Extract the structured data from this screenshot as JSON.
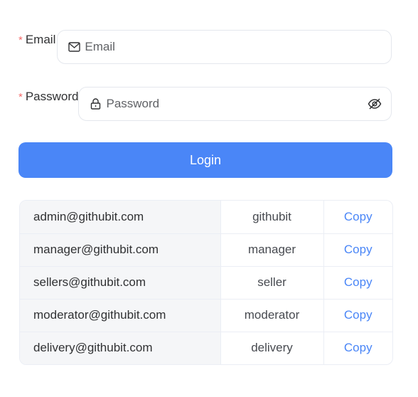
{
  "form": {
    "email": {
      "label": "Email",
      "required_mark": "*",
      "placeholder": "Email",
      "value": "",
      "icon": "mail-icon"
    },
    "password": {
      "label": "Password",
      "required_mark": "*",
      "placeholder": "Password",
      "value": "",
      "icon": "lock-icon",
      "toggle_icon": "eye-slash-icon"
    },
    "login_label": "Login"
  },
  "accounts": {
    "rows": [
      {
        "email": "admin@githubit.com",
        "password": "githubit",
        "action": "Copy"
      },
      {
        "email": "manager@githubit.com",
        "password": "manager",
        "action": "Copy"
      },
      {
        "email": "sellers@githubit.com",
        "password": "seller",
        "action": "Copy"
      },
      {
        "email": "moderator@githubit.com",
        "password": "moderator",
        "action": "Copy"
      },
      {
        "email": "delivery@githubit.com",
        "password": "delivery",
        "action": "Copy"
      }
    ]
  },
  "colors": {
    "primary": "#4a86f7",
    "required": "#f56c6c",
    "border": "#e4e7ed",
    "table_label_bg": "#f5f6f8"
  }
}
